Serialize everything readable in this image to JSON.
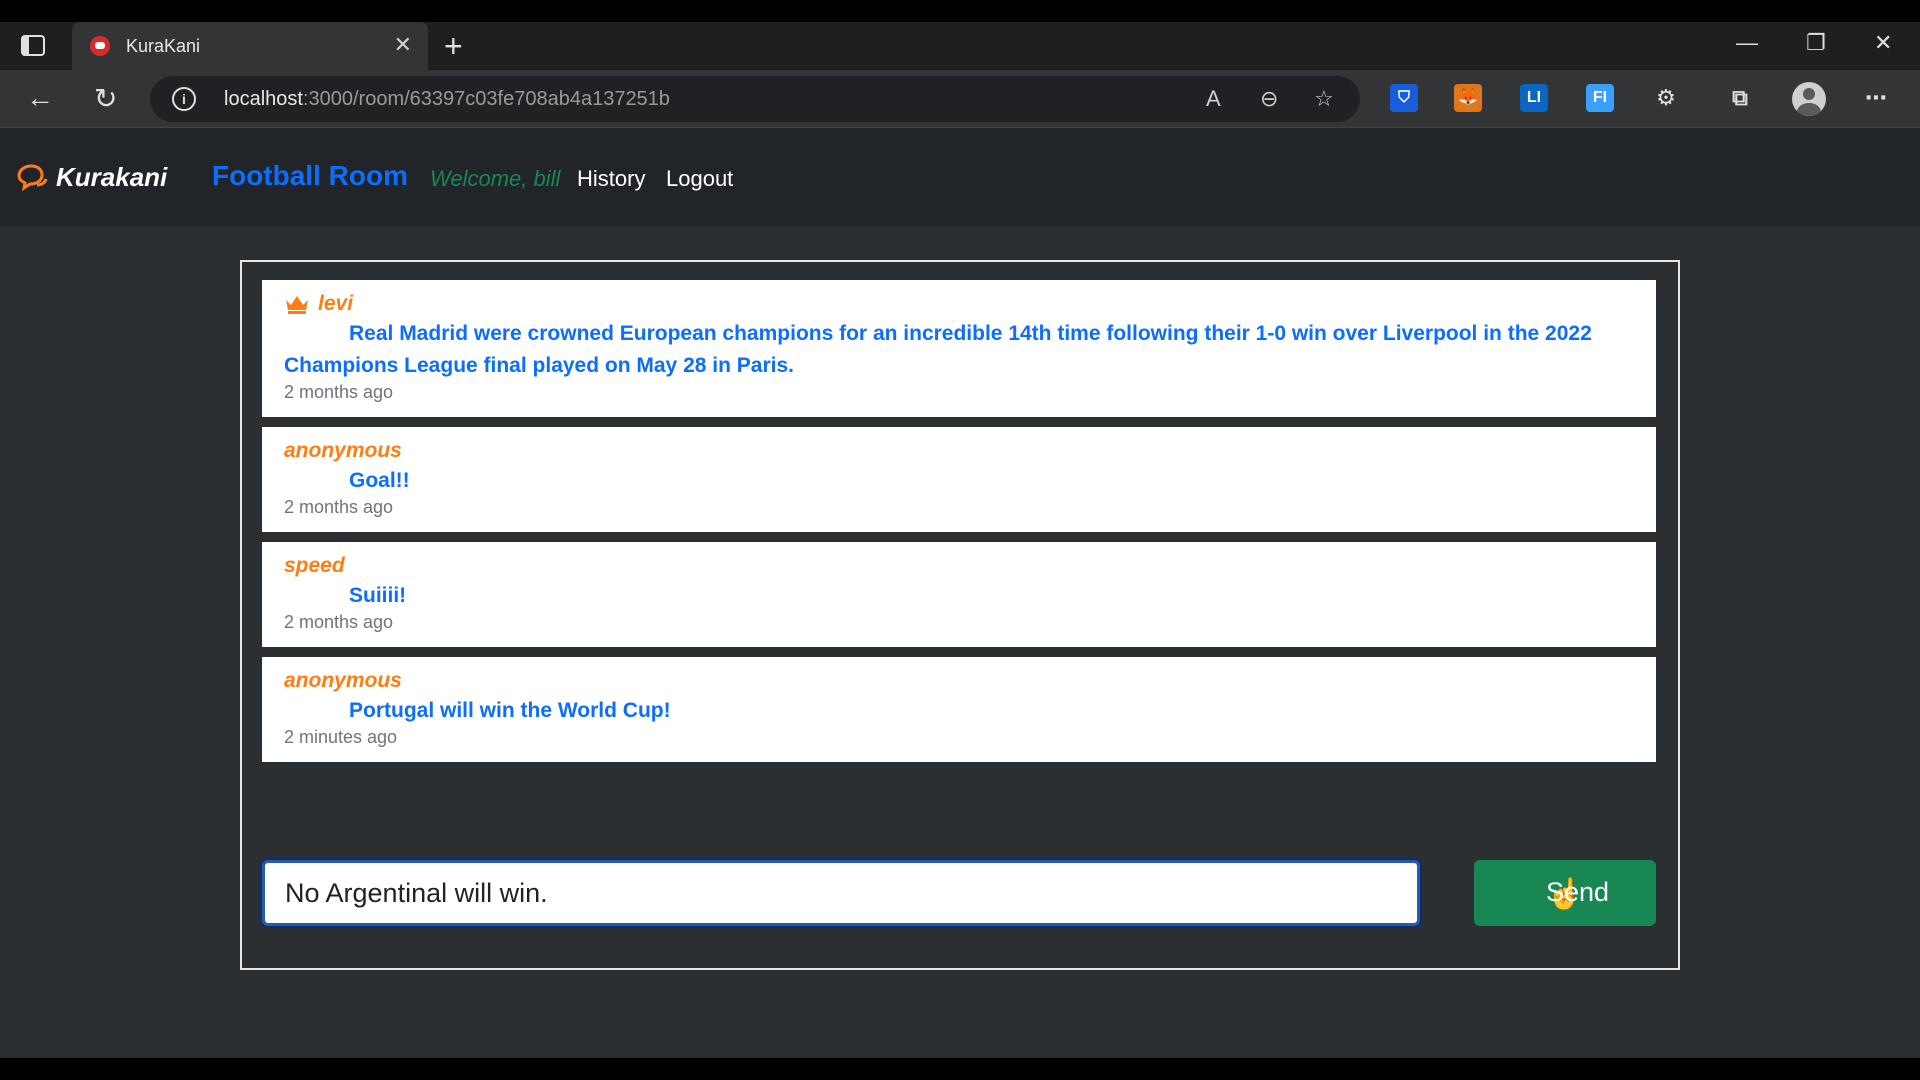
{
  "browser": {
    "tab_title": "KuraKani",
    "url_host": "localhost",
    "url_path": ":3000/room/63397c03fe708ab4a137251b",
    "icons": [
      "tab-actions-icon",
      "favicon",
      "close-icon",
      "new-tab-icon",
      "minimize-icon",
      "restore-icon",
      "window-close-icon",
      "back-icon",
      "refresh-icon",
      "info-icon",
      "read-aloud-icon",
      "zoom-out-icon",
      "favorites-icon",
      "bitwarden-icon",
      "metamask-icon",
      "li-extension-icon",
      "fi-extension-icon",
      "extensions-icon",
      "collections-icon",
      "profile-icon",
      "more-icon"
    ]
  },
  "navbar": {
    "brand": "Kurakani",
    "room": "Football Room",
    "welcome": "Welcome, bill",
    "history": "History",
    "logout": "Logout"
  },
  "messages": [
    {
      "user": "levi",
      "crown": true,
      "text": "Real Madrid were crowned European champions for an incredible 14th time following their 1-0 win over Liverpool in the 2022 Champions League final played on May 28 in Paris.",
      "time": "2 months ago"
    },
    {
      "user": "anonymous",
      "crown": false,
      "text": "Goal!!",
      "time": "2 months ago"
    },
    {
      "user": "speed",
      "crown": false,
      "text": "Suiiii!",
      "time": "2 months ago"
    },
    {
      "user": "anonymous",
      "crown": false,
      "text": "Portugal will win the World Cup!",
      "time": "2 minutes ago"
    }
  ],
  "composer": {
    "value": "No Argentinal will win.",
    "send_label": "Send"
  },
  "colors": {
    "brand_accent": "#fd7e14",
    "room_blue": "#0d6efd",
    "welcome_green": "#198754",
    "send_green": "#198754"
  }
}
